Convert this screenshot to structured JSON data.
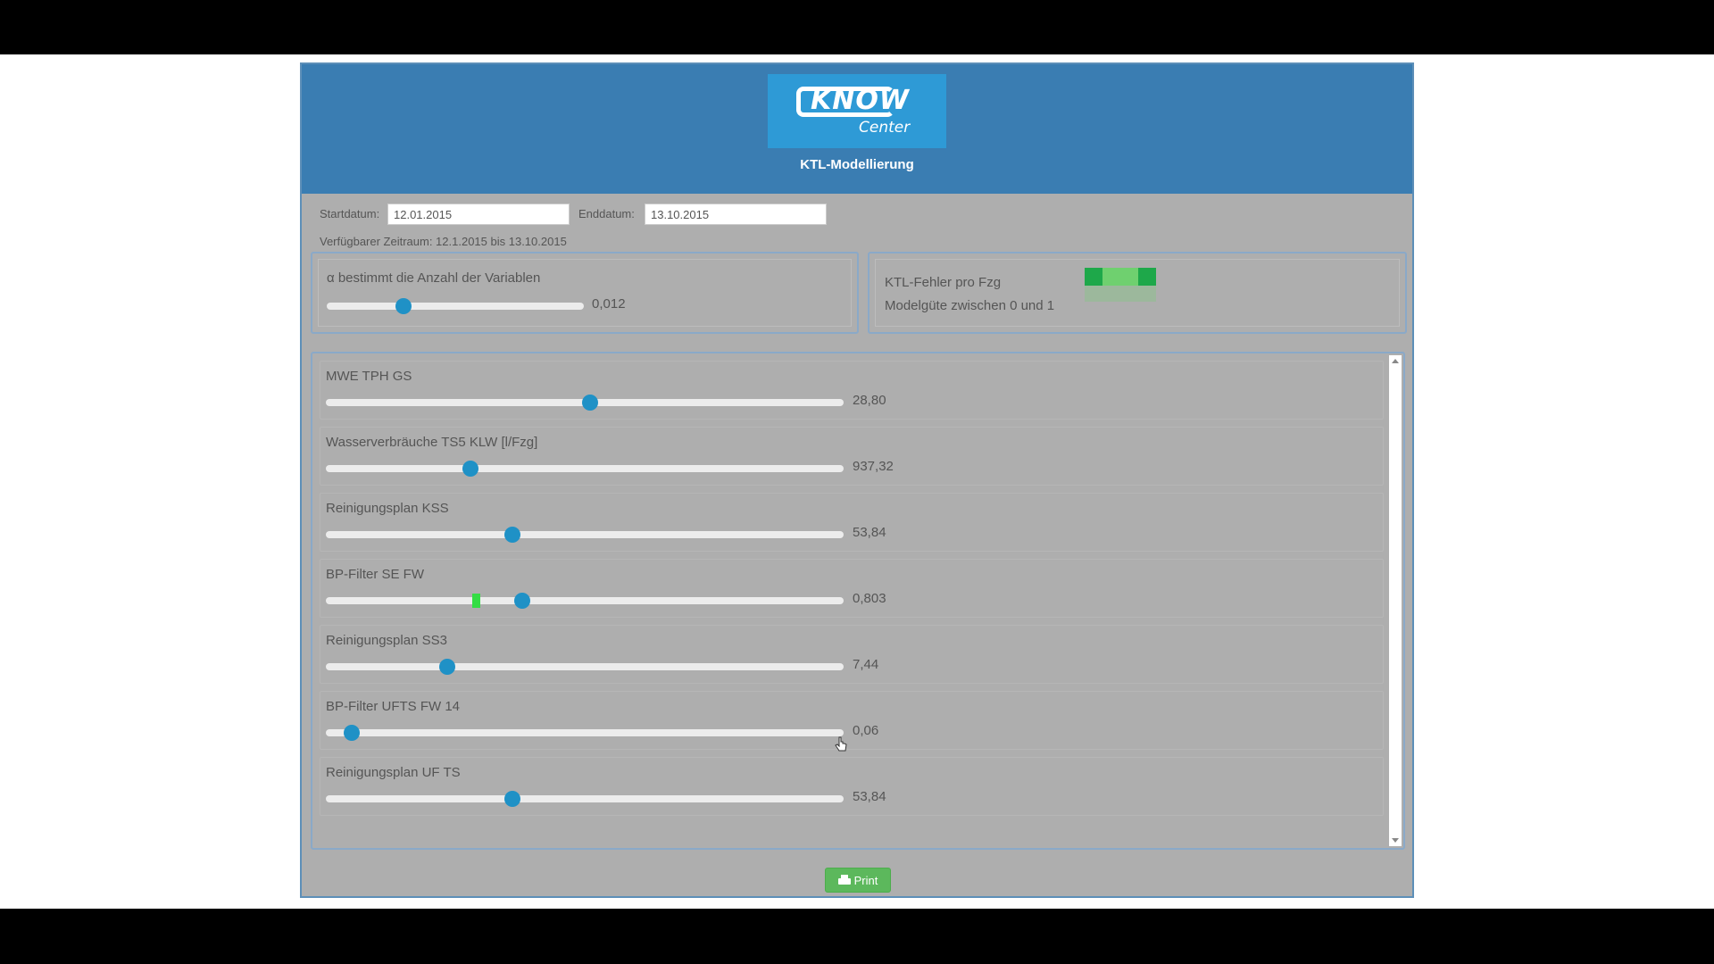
{
  "header": {
    "logo_know": "KNOW",
    "logo_center": "Center",
    "title": "KTL-Modellierung"
  },
  "dates": {
    "start_label": "Startdatum:",
    "start_value": "12.01.2015",
    "end_label": "Enddatum:",
    "end_value": "13.10.2015",
    "available_range": "Verfügbarer Zeitraum: 12.1.2015 bis 13.10.2015"
  },
  "alpha_panel": {
    "label": "α bestimmt die Anzahl der Variablen",
    "value": "0,012",
    "position": 0.3
  },
  "error_panel": {
    "line1": "KTL-Fehler pro Fzg",
    "line2": "Modelgüte zwischen 0 und 1",
    "swatch_colors": [
      "#1ea84a",
      "#6fd06f",
      "#1ea84a",
      "#9cb89c"
    ]
  },
  "variables": [
    {
      "label": "MWE TPH GS",
      "value": "28,80",
      "position": 0.51,
      "marker": null
    },
    {
      "label": "Wasserverbräuche TS5 KLW [l/Fzg]",
      "value": "937,32",
      "position": 0.28,
      "marker": null
    },
    {
      "label": "Reinigungsplan KSS",
      "value": "53,84",
      "position": 0.36,
      "marker": null
    },
    {
      "label": "BP-Filter SE FW",
      "value": "0,803",
      "position": 0.38,
      "marker": 0.29
    },
    {
      "label": "Reinigungsplan SS3",
      "value": "7,44",
      "position": 0.235,
      "marker": null
    },
    {
      "label": "BP-Filter UFTS FW 14",
      "value": "0,06",
      "position": 0.05,
      "marker": null
    },
    {
      "label": "Reinigungsplan UF TS",
      "value": "53,84",
      "position": 0.36,
      "marker": null
    }
  ],
  "colors": {
    "header": "#3a7db2",
    "thumb": "#1f91c6",
    "marker": "#33dd44",
    "print_button": "#5cb85c"
  },
  "print_button": {
    "label": "Print",
    "icon": "printer-icon"
  }
}
